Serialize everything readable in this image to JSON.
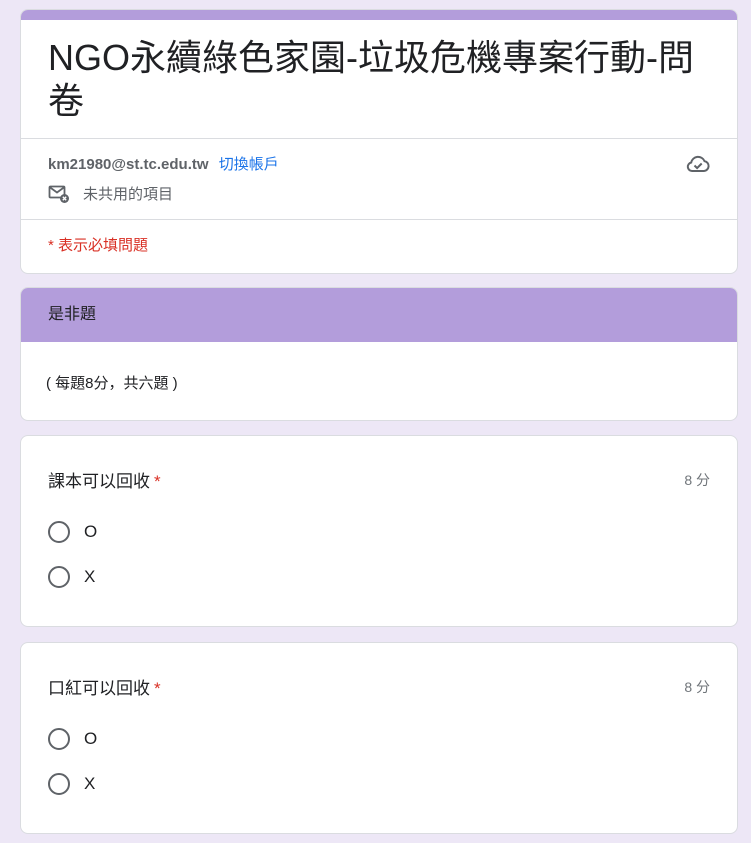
{
  "header": {
    "title": "NGO永續綠色家園-垃圾危機專案行動-問卷",
    "email": "km21980@st.tc.edu.tw",
    "switch_account": "切換帳戶",
    "share_status": "未共用的項目",
    "required_note": "* 表示必填問題"
  },
  "section": {
    "title": "是非題",
    "description": "( 每題8分，共六題 )"
  },
  "questions": [
    {
      "title": "課本可以回收",
      "required_mark": "*",
      "points": "8 分",
      "options": [
        "O",
        "X"
      ]
    },
    {
      "title": "口紅可以回收",
      "required_mark": "*",
      "points": "8 分",
      "options": [
        "O",
        "X"
      ]
    }
  ],
  "colors": {
    "background": "#ede7f6",
    "accent": "#b39ddb",
    "link": "#1a73e8",
    "required": "#d93025"
  }
}
